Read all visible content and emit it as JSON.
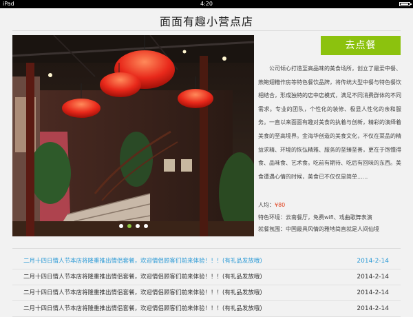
{
  "status_bar": {
    "device": "iPad",
    "time": "4:20"
  },
  "page": {
    "title": "面面有趣小营点店"
  },
  "order_button": {
    "label": "去点餐",
    "color": "#8cc20e"
  },
  "carousel": {
    "slide_count": 4,
    "active_index": 1
  },
  "description": "公司倾心打造至高品味的美食场所，创立了最爱中餐、燕鲍翅糟作房等特色餐饮品牌，将传统大型中餐与特色餐饮相结合，形成独特的店中店模式，满足不同消费群体的不同需求。专业的团队，个性化的装修、极显人性化的亲和服务。一直以来面面有趣对美食的执着与创新，精彩的演绎着美食的至高境界。金海华创造的美食文化，不仅在菜品的精益求精、环境的恢弘精雅、服务的至臻至善，更在于饱懂得食、品味食、艺术食。吃前有期待、吃后有回味的东西。美食遭遇心情的时候，美食已不仅仅是简单......",
  "info": {
    "avg_label": "人均：",
    "avg_price": "¥80",
    "price_color": "#e0401c",
    "environment": "特色环境：云南餐厅，免费wifi、戏曲歌舞表演",
    "atmosphere": "就餐氛围：中国最具风情的雅地简直就是人间仙境"
  },
  "news": [
    {
      "title": "二月十四日情人节本店将隆重推出情侣套餐，欢迎情侣顾客们前来体验！！！(有礼品发放哦)",
      "date": "2014-2-14",
      "highlight": true
    },
    {
      "title": "二月十四日情人节本店将隆重推出情侣套餐，欢迎情侣顾客们前来体验！！！(有礼品发放哦)",
      "date": "2014-2-14",
      "highlight": false
    },
    {
      "title": "二月十四日情人节本店将隆重推出情侣套餐，欢迎情侣顾客们前来体验！！！(有礼品发放哦)",
      "date": "2014-2-14",
      "highlight": false
    },
    {
      "title": "二月十四日情人节本店将隆重推出情侣套餐，欢迎情侣顾客们前来体验！！！(有礼品发放哦)",
      "date": "2014-2-14",
      "highlight": false
    }
  ],
  "colors": {
    "highlight_text": "#2e9bd6",
    "active_dot": "#8cc63f"
  }
}
